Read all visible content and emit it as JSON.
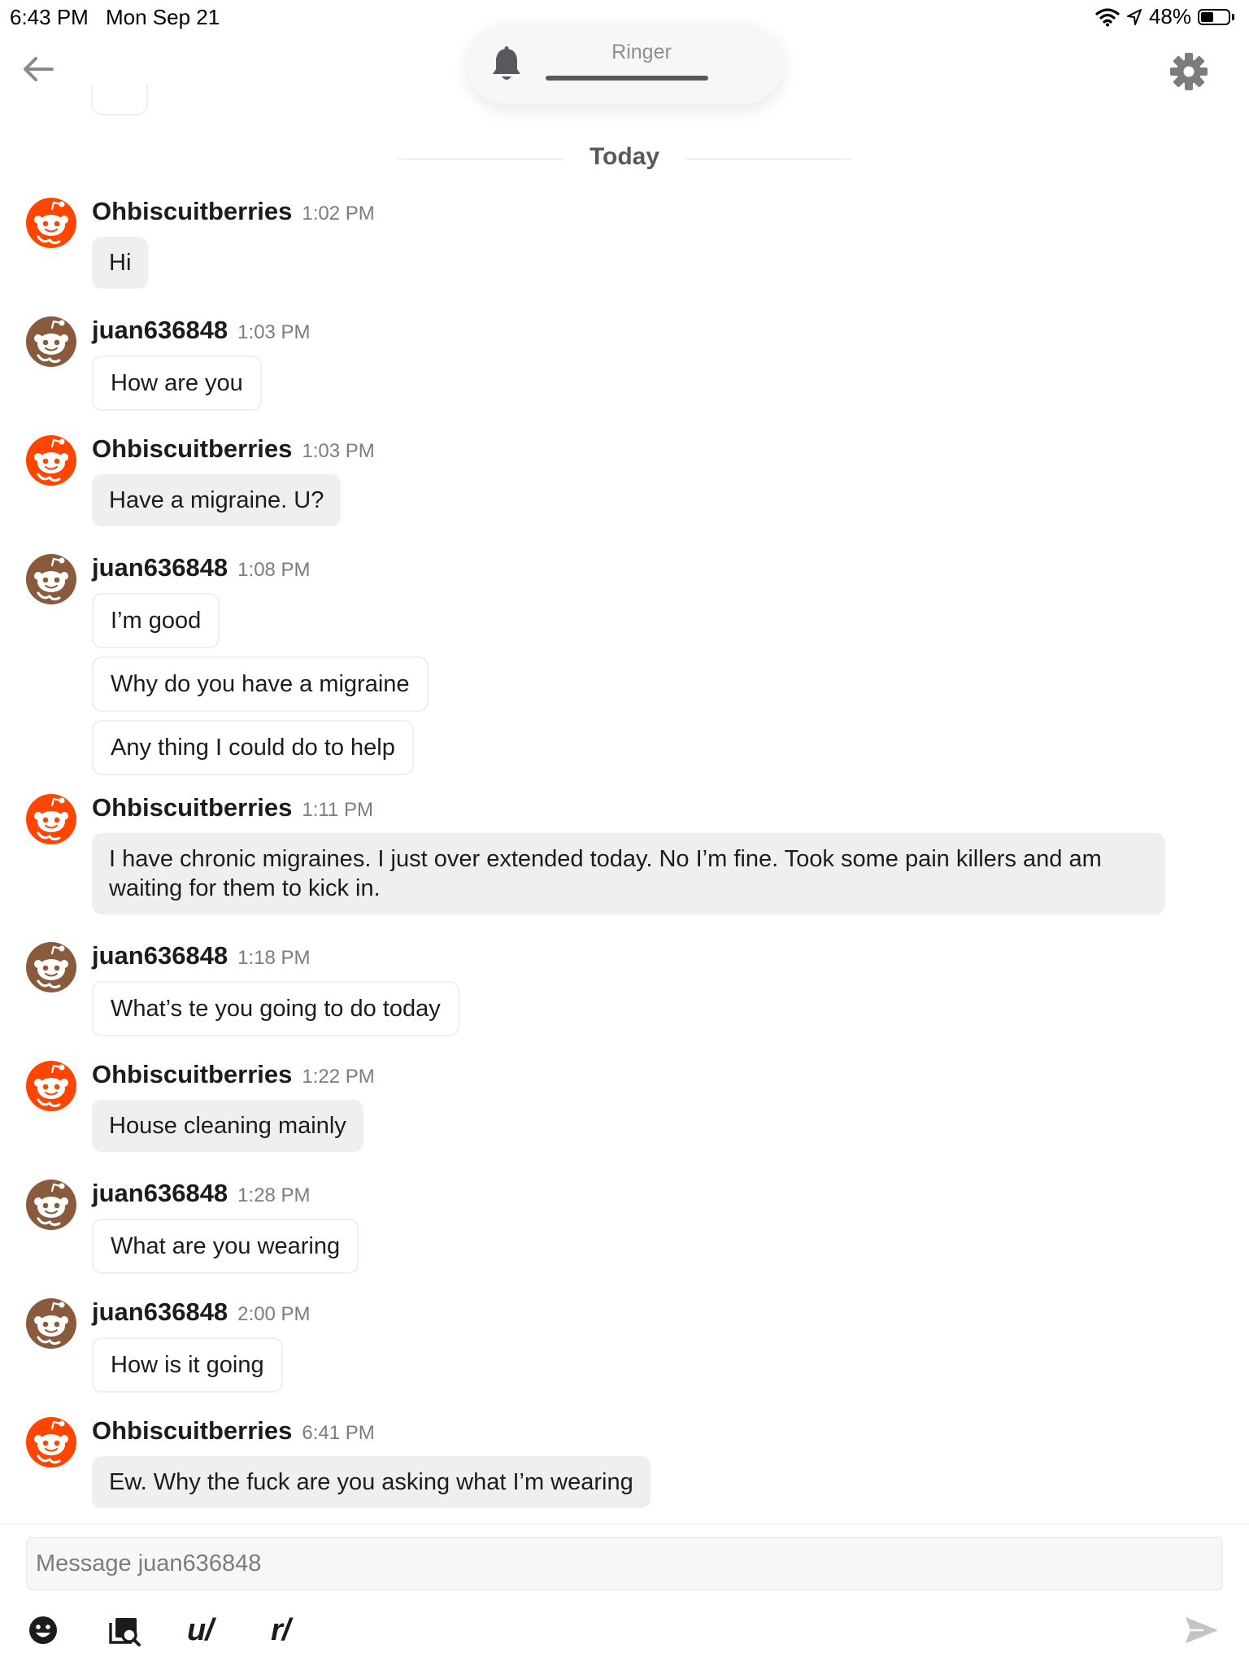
{
  "status_bar": {
    "time": "6:43 PM",
    "date": "Mon Sep 21",
    "battery_text": "48%",
    "battery_level": 0.48
  },
  "header": {
    "ringer_label": "Ringer"
  },
  "day_divider": "Today",
  "colors": {
    "reddit_orange": "#ff4500",
    "juan_avatar": "#8a5a3c",
    "bubble_gray": "#edeff1"
  },
  "messages": [
    {
      "user": "Ohbiscuitberries",
      "time": "1:02 PM",
      "lines": [
        "Hi"
      ]
    },
    {
      "user": "juan636848",
      "time": "1:03 PM",
      "lines": [
        "How are you"
      ]
    },
    {
      "user": "Ohbiscuitberries",
      "time": "1:03 PM",
      "lines": [
        "Have a migraine.  U?"
      ]
    },
    {
      "user": "juan636848",
      "time": "1:08 PM",
      "lines": [
        "I’m good",
        "Why do you have a migraine",
        "Any thing I could do to help"
      ]
    },
    {
      "user": "Ohbiscuitberries",
      "time": "1:11 PM",
      "lines": [
        "I have chronic migraines.  I just over extended today.  No I’m fine.  Took some pain killers and am waiting for them to kick in."
      ]
    },
    {
      "user": "juan636848",
      "time": "1:18 PM",
      "lines": [
        "What’s te you going to do today"
      ]
    },
    {
      "user": "Ohbiscuitberries",
      "time": "1:22 PM",
      "lines": [
        "House cleaning mainly"
      ]
    },
    {
      "user": "juan636848",
      "time": "1:28 PM",
      "lines": [
        "What are you wearing"
      ]
    },
    {
      "user": "juan636848",
      "time": "2:00 PM",
      "lines": [
        "How is it going"
      ]
    },
    {
      "user": "Ohbiscuitberries",
      "time": "6:41 PM",
      "lines": [
        "Ew.  Why the fuck are you asking what I’m wearing"
      ]
    }
  ],
  "composer": {
    "placeholder": "Message juan636848",
    "user_mention_label": "u/",
    "subreddit_mention_label": "r/"
  }
}
